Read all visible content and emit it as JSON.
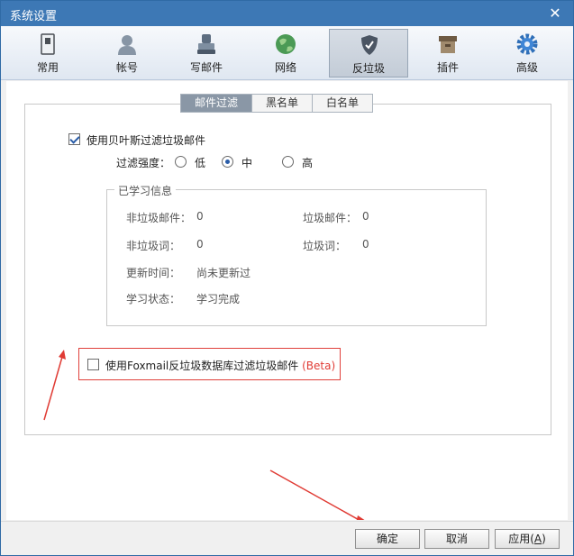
{
  "window": {
    "title": "系统设置",
    "close_label": "✕"
  },
  "toolbar": {
    "items": [
      {
        "label": "常用"
      },
      {
        "label": "帐号"
      },
      {
        "label": "写邮件"
      },
      {
        "label": "网络"
      },
      {
        "label": "反垃圾",
        "active": true
      },
      {
        "label": "插件"
      },
      {
        "label": "高级"
      }
    ]
  },
  "subtabs": [
    {
      "label": "邮件过滤",
      "active": true
    },
    {
      "label": "黑名单"
    },
    {
      "label": "白名单"
    }
  ],
  "filter": {
    "bayes_label": "使用贝叶斯过滤垃圾邮件",
    "bayes_checked": true,
    "strength_label": "过滤强度：",
    "options": [
      "低",
      "中",
      "高"
    ],
    "selected": "中"
  },
  "learned": {
    "title": "已学习信息",
    "nonspam_mail_label": "非垃圾邮件：",
    "nonspam_mail_value": "0",
    "spam_mail_label": "垃圾邮件：",
    "spam_mail_value": "0",
    "nonspam_word_label": "非垃圾词：",
    "nonspam_word_value": "0",
    "spam_word_label": "垃圾词：",
    "spam_word_value": "0",
    "update_label": "更新时间：",
    "update_value": "尚未更新过",
    "state_label": "学习状态：",
    "state_value": "学习完成"
  },
  "foxmail_db": {
    "label": "使用Foxmail反垃圾数据库过滤垃圾邮件",
    "beta": "(Beta)",
    "checked": false
  },
  "footer": {
    "ok": "确定",
    "cancel": "取消",
    "apply_prefix": "应用(",
    "apply_key": "A",
    "apply_suffix": ")"
  },
  "colors": {
    "titlebar": "#3d78b5",
    "beta": "#e03b34",
    "highlight_border": "#e0403b"
  }
}
